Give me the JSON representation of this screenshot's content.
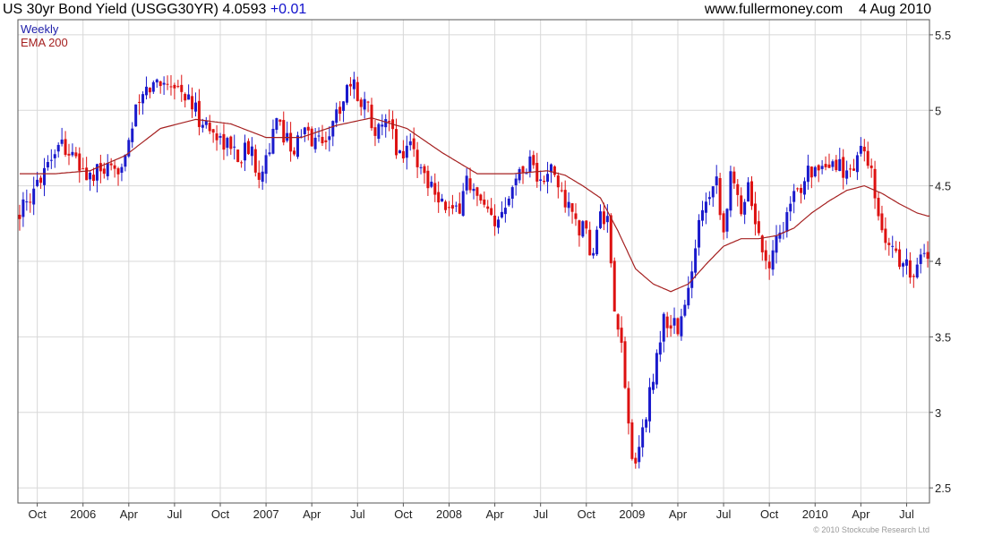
{
  "header": {
    "title": "US 30yr Bond Yield (USGG30YR) 4.0593",
    "change": "+0.01",
    "site": "www.fullermoney.com",
    "date": "4 Aug 2010"
  },
  "legend": {
    "weekly": "Weekly",
    "ema": "EMA 200"
  },
  "copyright": "© 2010 Stockcube Research Ltd",
  "colors": {
    "up": "#1a1acc",
    "down": "#dd1111",
    "ema": "#a52020",
    "grid": "#d8d8d8",
    "legendWeekly": "#2020aa",
    "legendEma": "#a52020"
  },
  "chart_data": {
    "type": "candlestick",
    "ylim": [
      2.4,
      5.6
    ],
    "yticks": [
      2.5,
      3,
      3.5,
      4,
      4.5,
      5,
      5.5
    ],
    "ytick_labels": [
      "2.5",
      "3",
      "3.5",
      "4",
      "4.5",
      "5",
      "5.5"
    ],
    "xticks": [
      {
        "label": "Oct",
        "week": 5
      },
      {
        "label": "2006",
        "week": 18
      },
      {
        "label": "Apr",
        "week": 31
      },
      {
        "label": "Jul",
        "week": 44
      },
      {
        "label": "Oct",
        "week": 57
      },
      {
        "label": "2007",
        "week": 70
      },
      {
        "label": "Apr",
        "week": 83
      },
      {
        "label": "Jul",
        "week": 96
      },
      {
        "label": "Oct",
        "week": 109
      },
      {
        "label": "2008",
        "week": 122
      },
      {
        "label": "Apr",
        "week": 135
      },
      {
        "label": "Jul",
        "week": 148
      },
      {
        "label": "Oct",
        "week": 161
      },
      {
        "label": "2009",
        "week": 174
      },
      {
        "label": "Apr",
        "week": 187
      },
      {
        "label": "Jul",
        "week": 200
      },
      {
        "label": "Oct",
        "week": 213
      },
      {
        "label": "2010",
        "week": 226
      },
      {
        "label": "Apr",
        "week": 239
      },
      {
        "label": "Jul",
        "week": 252
      }
    ],
    "week_range": [
      -0.5,
      258.5
    ],
    "close_keypoints": [
      [
        0,
        4.35
      ],
      [
        3,
        4.35
      ],
      [
        5,
        4.55
      ],
      [
        10,
        4.75
      ],
      [
        12,
        4.8
      ],
      [
        16,
        4.65
      ],
      [
        20,
        4.55
      ],
      [
        24,
        4.6
      ],
      [
        27,
        4.55
      ],
      [
        30,
        4.75
      ],
      [
        34,
        5.05
      ],
      [
        37,
        5.15
      ],
      [
        40,
        5.2
      ],
      [
        43,
        5.2
      ],
      [
        47,
        5.1
      ],
      [
        51,
        4.95
      ],
      [
        55,
        4.85
      ],
      [
        58,
        4.8
      ],
      [
        62,
        4.7
      ],
      [
        65,
        4.75
      ],
      [
        68,
        4.6
      ],
      [
        70,
        4.7
      ],
      [
        73,
        4.9
      ],
      [
        75,
        4.85
      ],
      [
        78,
        4.75
      ],
      [
        81,
        4.85
      ],
      [
        84,
        4.8
      ],
      [
        86,
        4.8
      ],
      [
        89,
        4.9
      ],
      [
        92,
        5.1
      ],
      [
        94,
        5.2
      ],
      [
        96,
        5.1
      ],
      [
        98,
        5.05
      ],
      [
        100,
        4.95
      ],
      [
        102,
        4.85
      ],
      [
        105,
        4.9
      ],
      [
        108,
        4.7
      ],
      [
        111,
        4.8
      ],
      [
        114,
        4.6
      ],
      [
        118,
        4.5
      ],
      [
        121,
        4.35
      ],
      [
        124,
        4.3
      ],
      [
        127,
        4.55
      ],
      [
        130,
        4.4
      ],
      [
        133,
        4.3
      ],
      [
        135,
        4.2
      ],
      [
        137,
        4.35
      ],
      [
        140,
        4.55
      ],
      [
        143,
        4.6
      ],
      [
        145,
        4.7
      ],
      [
        148,
        4.5
      ],
      [
        151,
        4.6
      ],
      [
        154,
        4.45
      ],
      [
        157,
        4.3
      ],
      [
        160,
        4.2
      ],
      [
        163,
        4.05
      ],
      [
        165,
        4.3
      ],
      [
        167,
        4.25
      ],
      [
        169,
        3.6
      ],
      [
        171,
        3.45
      ],
      [
        173,
        2.9
      ],
      [
        175,
        2.6
      ],
      [
        177,
        2.9
      ],
      [
        179,
        3.1
      ],
      [
        181,
        3.4
      ],
      [
        183,
        3.6
      ],
      [
        185,
        3.6
      ],
      [
        187,
        3.55
      ],
      [
        189,
        3.7
      ],
      [
        191,
        3.9
      ],
      [
        193,
        4.3
      ],
      [
        195,
        4.45
      ],
      [
        198,
        4.55
      ],
      [
        200,
        4.2
      ],
      [
        202,
        4.55
      ],
      [
        205,
        4.35
      ],
      [
        207,
        4.55
      ],
      [
        209,
        4.25
      ],
      [
        211,
        4.1
      ],
      [
        213,
        4.0
      ],
      [
        215,
        4.15
      ],
      [
        218,
        4.3
      ],
      [
        221,
        4.45
      ],
      [
        224,
        4.65
      ],
      [
        227,
        4.55
      ],
      [
        230,
        4.6
      ],
      [
        233,
        4.65
      ],
      [
        236,
        4.55
      ],
      [
        238,
        4.75
      ],
      [
        240,
        4.7
      ],
      [
        242,
        4.55
      ],
      [
        244,
        4.25
      ],
      [
        246,
        4.15
      ],
      [
        248,
        4.1
      ],
      [
        250,
        4.0
      ],
      [
        253,
        3.95
      ],
      [
        256,
        4.0
      ],
      [
        258,
        4.06
      ]
    ],
    "ema_keypoints": [
      [
        0,
        4.58
      ],
      [
        10,
        4.58
      ],
      [
        20,
        4.6
      ],
      [
        30,
        4.7
      ],
      [
        40,
        4.88
      ],
      [
        50,
        4.94
      ],
      [
        60,
        4.91
      ],
      [
        70,
        4.82
      ],
      [
        80,
        4.82
      ],
      [
        90,
        4.9
      ],
      [
        100,
        4.95
      ],
      [
        110,
        4.88
      ],
      [
        120,
        4.72
      ],
      [
        130,
        4.58
      ],
      [
        140,
        4.58
      ],
      [
        150,
        4.6
      ],
      [
        155,
        4.57
      ],
      [
        160,
        4.5
      ],
      [
        165,
        4.42
      ],
      [
        170,
        4.2
      ],
      [
        175,
        3.95
      ],
      [
        180,
        3.85
      ],
      [
        185,
        3.8
      ],
      [
        190,
        3.85
      ],
      [
        195,
        3.98
      ],
      [
        200,
        4.1
      ],
      [
        205,
        4.15
      ],
      [
        210,
        4.15
      ],
      [
        215,
        4.17
      ],
      [
        220,
        4.22
      ],
      [
        225,
        4.32
      ],
      [
        230,
        4.4
      ],
      [
        235,
        4.47
      ],
      [
        240,
        4.5
      ],
      [
        245,
        4.45
      ],
      [
        250,
        4.38
      ],
      [
        255,
        4.32
      ],
      [
        258,
        4.3
      ]
    ]
  }
}
